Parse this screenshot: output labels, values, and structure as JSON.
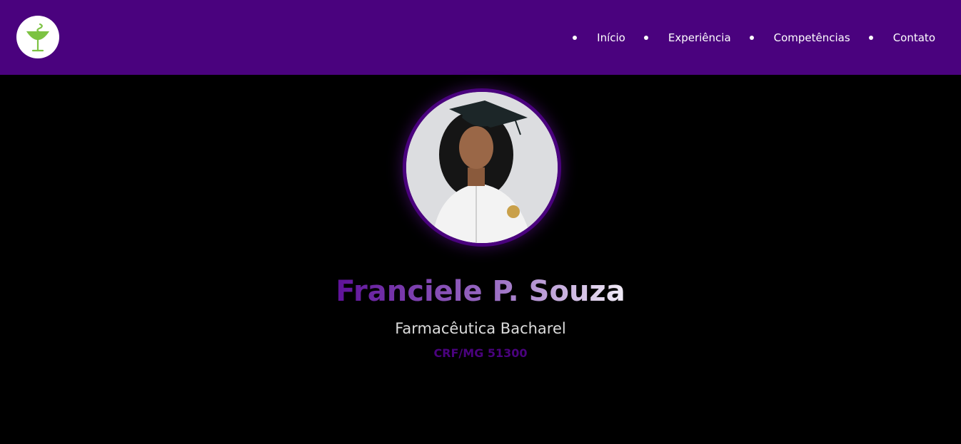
{
  "header": {
    "logo_icon": "rod-of-asclepius-bowl-icon",
    "background_color": "#4a027e",
    "nav": [
      {
        "label": "Início"
      },
      {
        "label": "Experiência"
      },
      {
        "label": "Competências"
      },
      {
        "label": "Contato"
      }
    ]
  },
  "profile": {
    "photo_icon": "profile-photo",
    "name": "Franciele P. Souza",
    "title": "Farmacêutica Bacharel",
    "registration": "CRF/MG 51300",
    "accent_color": "#4a027e"
  }
}
